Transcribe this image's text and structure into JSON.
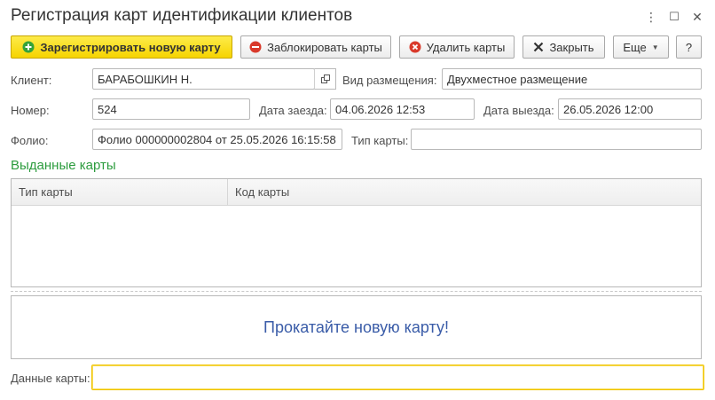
{
  "window": {
    "title": "Регистрация карт идентификации клиентов",
    "controls": {
      "more": "⋮",
      "maximize": "☐",
      "close": "✕"
    }
  },
  "toolbar": {
    "register": "Зарегистрировать новую карту",
    "block": "Заблокировать карты",
    "delete": "Удалить карты",
    "close": "Закрыть",
    "more": "Еще",
    "help": "?"
  },
  "form": {
    "client_label": "Клиент:",
    "client_value": "БАРАБОШКИН Н.",
    "accommodation_label": "Вид размещения:",
    "accommodation_value": "Двухместное размещение",
    "number_label": "Номер:",
    "number_value": "524",
    "checkin_label": "Дата заезда:",
    "checkin_value": "04.06.2026 12:53",
    "checkout_label": "Дата выезда:",
    "checkout_value": "26.05.2026 12:00",
    "folio_label": "Фолио:",
    "folio_value": "Фолио 000000002804 от 25.05.2026 16:15:58",
    "card_type_label": "Тип карты:",
    "card_type_value": ""
  },
  "issued": {
    "title": "Выданные карты",
    "columns": [
      "Тип карты",
      "Код карты"
    ],
    "rows": []
  },
  "swipe_prompt": "Прокатайте новую карту!",
  "card_data": {
    "label": "Данные карты:",
    "value": ""
  },
  "colors": {
    "primary_button": "#f6d400",
    "section_title": "#2c9c3e",
    "prompt_text": "#3a5ca8",
    "focus_border": "#f0c400"
  }
}
